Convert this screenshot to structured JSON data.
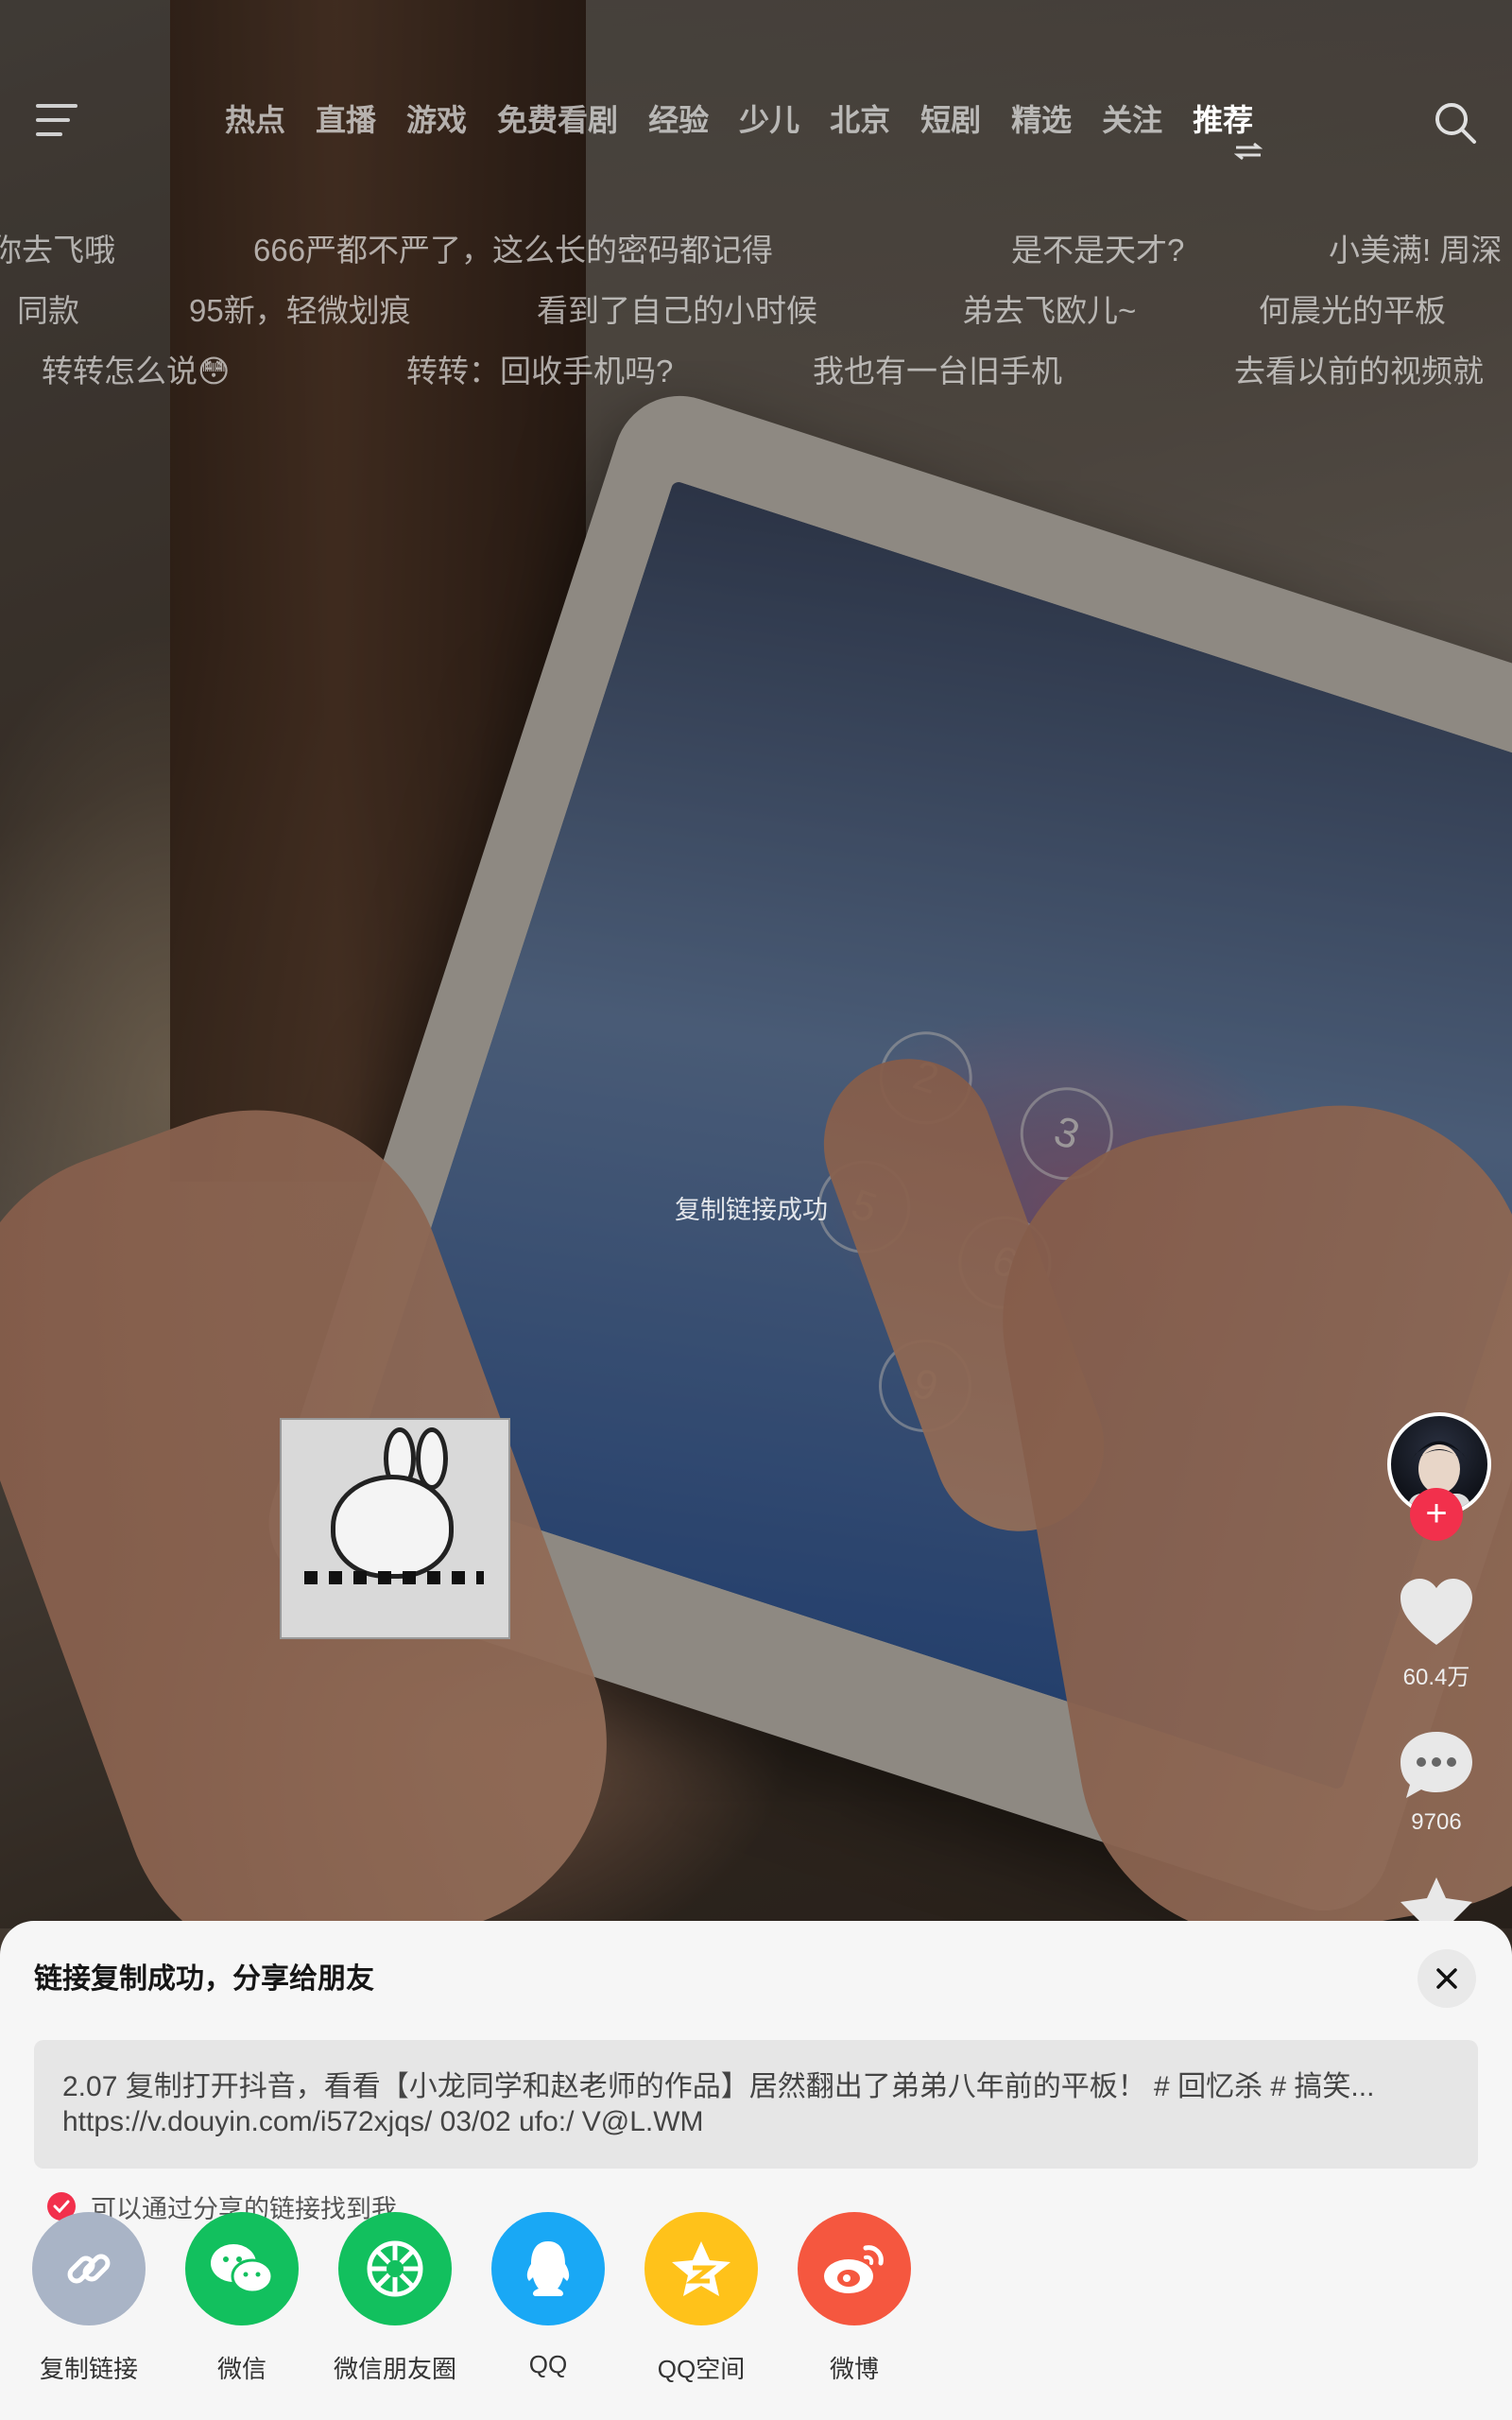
{
  "top_nav": {
    "tabs": [
      "热点",
      "直播",
      "游戏",
      "免费看剧",
      "经验",
      "少儿",
      "北京",
      "短剧",
      "精选",
      "关注",
      "推荐"
    ],
    "active_tab": "推荐"
  },
  "danmaku": [
    "你去飞哦",
    "666严都不严了，这么长的密码都记得",
    "是不是天才?",
    "小美满! 周深",
    "同款",
    "95新，轻微划痕",
    "看到了自己的小时候",
    "弟去飞欧儿~",
    "何晨光的平板",
    "转转怎么说😳",
    "转转：回收手机吗?",
    "我也有一台旧手机",
    "去看以前的视频就"
  ],
  "toast": "复制链接成功",
  "rail": {
    "likes": "60.4万",
    "comments": "9706"
  },
  "share_sheet": {
    "title": "链接复制成功，分享给朋友",
    "link_line1": "2.07 复制打开抖音，看看【小龙同学和赵老师的作品】居然翻出了弟弟八年前的平板！ # 回忆杀 # 搞笑...",
    "link_line2": "https://v.douyin.com/i572xjqs/ 03/02 ufo:/ V@L.WM",
    "findable_label": "可以通过分享的链接找到我",
    "targets": [
      {
        "label": "复制链接",
        "icon": "link-icon",
        "color": "#a9b4c6"
      },
      {
        "label": "微信",
        "icon": "wechat-icon",
        "color": "#12c05e"
      },
      {
        "label": "微信朋友圈",
        "icon": "moments-icon",
        "color": "#12c05e"
      },
      {
        "label": "QQ",
        "icon": "qq-icon",
        "color": "#19a8f5"
      },
      {
        "label": "QQ空间",
        "icon": "qzone-icon",
        "color": "#ffc21a"
      },
      {
        "label": "微博",
        "icon": "weibo-icon",
        "color": "#f5573f"
      }
    ]
  },
  "colors": {
    "accent": "#f2304c"
  }
}
